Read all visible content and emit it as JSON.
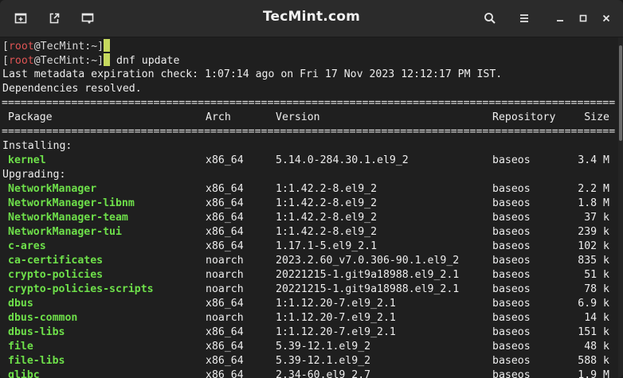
{
  "window": {
    "title": "TecMint.com",
    "buttons": {
      "new_tab": "new-tab-icon",
      "detach": "detach-tab-icon",
      "new_window": "new-window-icon",
      "search": "search-icon",
      "menu": "hamburger-menu-icon",
      "minimize": "minimize-icon",
      "maximize": "maximize-icon",
      "close": "close-icon"
    }
  },
  "terminal": {
    "prompt": {
      "open": "[",
      "user": "root",
      "at": "@",
      "host": "TecMint",
      "path": ":~",
      "close": "]"
    },
    "prompt1_command": "",
    "prompt2_command": " dnf update",
    "output_line1": "Last metadata expiration check: 1:07:14 ago on Fri 17 Nov 2023 12:12:17 PM IST.",
    "output_line2": "Dependencies resolved.",
    "separator": "====================================================================================================================================================================",
    "headers": {
      "package": "Package",
      "arch": "Arch",
      "version": "Version",
      "repository": "Repository",
      "size": "Size"
    },
    "section_installing": "Installing:",
    "section_upgrading": "Upgrading:",
    "installing": [
      {
        "name": "kernel",
        "arch": "x86_64",
        "version": "5.14.0-284.30.1.el9_2",
        "repo": "baseos",
        "size": "3.4 M"
      }
    ],
    "upgrading": [
      {
        "name": "NetworkManager",
        "arch": "x86_64",
        "version": "1:1.42.2-8.el9_2",
        "repo": "baseos",
        "size": "2.2 M"
      },
      {
        "name": "NetworkManager-libnm",
        "arch": "x86_64",
        "version": "1:1.42.2-8.el9_2",
        "repo": "baseos",
        "size": "1.8 M"
      },
      {
        "name": "NetworkManager-team",
        "arch": "x86_64",
        "version": "1:1.42.2-8.el9_2",
        "repo": "baseos",
        "size": "37 k"
      },
      {
        "name": "NetworkManager-tui",
        "arch": "x86_64",
        "version": "1:1.42.2-8.el9_2",
        "repo": "baseos",
        "size": "239 k"
      },
      {
        "name": "c-ares",
        "arch": "x86_64",
        "version": "1.17.1-5.el9_2.1",
        "repo": "baseos",
        "size": "102 k"
      },
      {
        "name": "ca-certificates",
        "arch": "noarch",
        "version": "2023.2.60_v7.0.306-90.1.el9_2",
        "repo": "baseos",
        "size": "835 k"
      },
      {
        "name": "crypto-policies",
        "arch": "noarch",
        "version": "20221215-1.git9a18988.el9_2.1",
        "repo": "baseos",
        "size": "51 k"
      },
      {
        "name": "crypto-policies-scripts",
        "arch": "noarch",
        "version": "20221215-1.git9a18988.el9_2.1",
        "repo": "baseos",
        "size": "78 k"
      },
      {
        "name": "dbus",
        "arch": "x86_64",
        "version": "1:1.12.20-7.el9_2.1",
        "repo": "baseos",
        "size": "6.9 k"
      },
      {
        "name": "dbus-common",
        "arch": "noarch",
        "version": "1:1.12.20-7.el9_2.1",
        "repo": "baseos",
        "size": "14 k"
      },
      {
        "name": "dbus-libs",
        "arch": "x86_64",
        "version": "1:1.12.20-7.el9_2.1",
        "repo": "baseos",
        "size": "151 k"
      },
      {
        "name": "file",
        "arch": "x86_64",
        "version": "5.39-12.1.el9_2",
        "repo": "baseos",
        "size": "48 k"
      },
      {
        "name": "file-libs",
        "arch": "x86_64",
        "version": "5.39-12.1.el9_2",
        "repo": "baseos",
        "size": "588 k"
      },
      {
        "name": "glibc",
        "arch": "x86_64",
        "version": "2.34-60.el9_2.7",
        "repo": "baseos",
        "size": "1.9 M"
      }
    ]
  }
}
